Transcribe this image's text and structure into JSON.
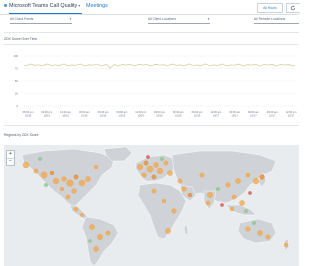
{
  "header": {
    "tab_active": "Microsoft Teams Call Quality",
    "tab_meetings": "Meetings",
    "time_range": "All Hours"
  },
  "filters": [
    {
      "label": "All Cloud Points",
      "selected": "All Cloud Points"
    },
    {
      "label": "All Client Locations",
      "selected": "All Client Locations"
    },
    {
      "label": "All Remote Locations",
      "selected": "All Remote Locations"
    }
  ],
  "line_chart": {
    "title": "ZDX Score Over Time",
    "y_ticks": [
      "100",
      "75",
      "50",
      "25",
      "0"
    ],
    "x_labels": [
      [
        "06:00 pm",
        "10/15"
      ],
      [
        "09:00 pm",
        "10/15"
      ],
      [
        "12:00 am",
        "10/16"
      ],
      [
        "03:00 am",
        "10/16"
      ],
      [
        "06:00 am",
        "10/16"
      ],
      [
        "09:00 am",
        "10/16"
      ],
      [
        "12:00 pm",
        "10/16"
      ],
      [
        "03:00 pm",
        "10/16"
      ],
      [
        "06:00 pm",
        "10/16"
      ],
      [
        "09:00 pm",
        "10/16"
      ],
      [
        "12:00 am",
        "10/17"
      ],
      [
        "03:00 am",
        "10/17"
      ],
      [
        "06:00 am",
        "10/17"
      ],
      [
        "09:00 am",
        "10/17"
      ],
      [
        "12:00 pm",
        "10/17"
      ]
    ]
  },
  "map": {
    "title": "Regions by ZDX Score",
    "zoom_in": "+",
    "zoom_out": "−",
    "colors": {
      "ocean": "#e9ecef",
      "land": "#cfd3d7",
      "orange": "#f0a54a",
      "orange_dark": "#e8892d",
      "green": "#8bc489",
      "red": "#d94b3f"
    }
  },
  "colors": {
    "accent": "#1c7ed6",
    "line_series": "#d6c88e",
    "grid": "#d4dae0"
  }
}
